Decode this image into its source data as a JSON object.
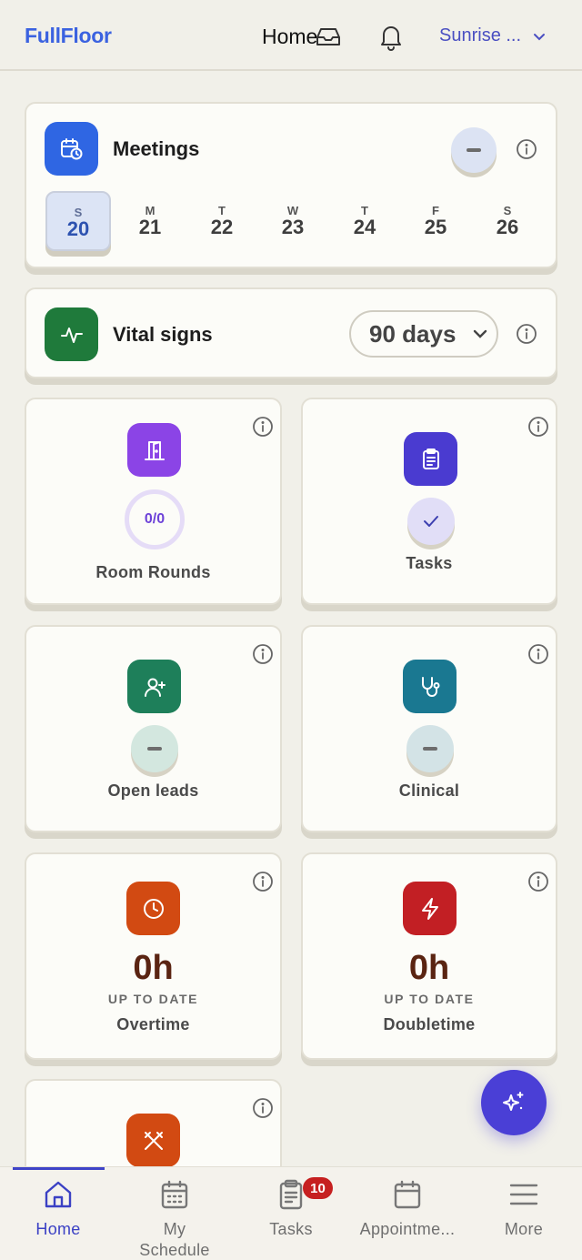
{
  "header": {
    "logo": "FullFloor",
    "title": "Home",
    "org_selector": "Sunrise ..."
  },
  "meetings": {
    "title": "Meetings",
    "days": [
      {
        "letter": "S",
        "num": "20",
        "selected": true
      },
      {
        "letter": "M",
        "num": "21"
      },
      {
        "letter": "T",
        "num": "22"
      },
      {
        "letter": "W",
        "num": "23"
      },
      {
        "letter": "T",
        "num": "24"
      },
      {
        "letter": "F",
        "num": "25"
      },
      {
        "letter": "S",
        "num": "26"
      }
    ]
  },
  "vitals": {
    "title": "Vital signs",
    "range_value": "90 days"
  },
  "tiles": {
    "room_rounds": {
      "label": "Room Rounds",
      "value": "0/0"
    },
    "tasks": {
      "label": "Tasks"
    },
    "open_leads": {
      "label": "Open leads"
    },
    "clinical": {
      "label": "Clinical"
    },
    "overtime": {
      "label": "Overtime",
      "value": "0h",
      "caption": "UP TO DATE"
    },
    "doubletime": {
      "label": "Doubletime",
      "value": "0h",
      "caption": "UP TO DATE"
    }
  },
  "bottom_nav": {
    "items": [
      {
        "label": "Home"
      },
      {
        "label": "My\nSchedule"
      },
      {
        "label": "Tasks"
      },
      {
        "label": "Appointme..."
      },
      {
        "label": "More"
      }
    ],
    "tasks_badge": "10"
  },
  "colors": {
    "brand": "#3b62e0",
    "meetings_icon": "#2f66e3",
    "vitals_icon": "#1f7a3b",
    "room_rounds_icon": "#8b44e6",
    "tasks_icon": "#4a3bd0",
    "open_leads_icon": "#1e7f5a",
    "clinical_icon": "#1a7891",
    "overtime_icon": "#d24a12",
    "doubletime_icon": "#c21f24",
    "fab": "#4a3fd6",
    "badge": "#c62020"
  }
}
